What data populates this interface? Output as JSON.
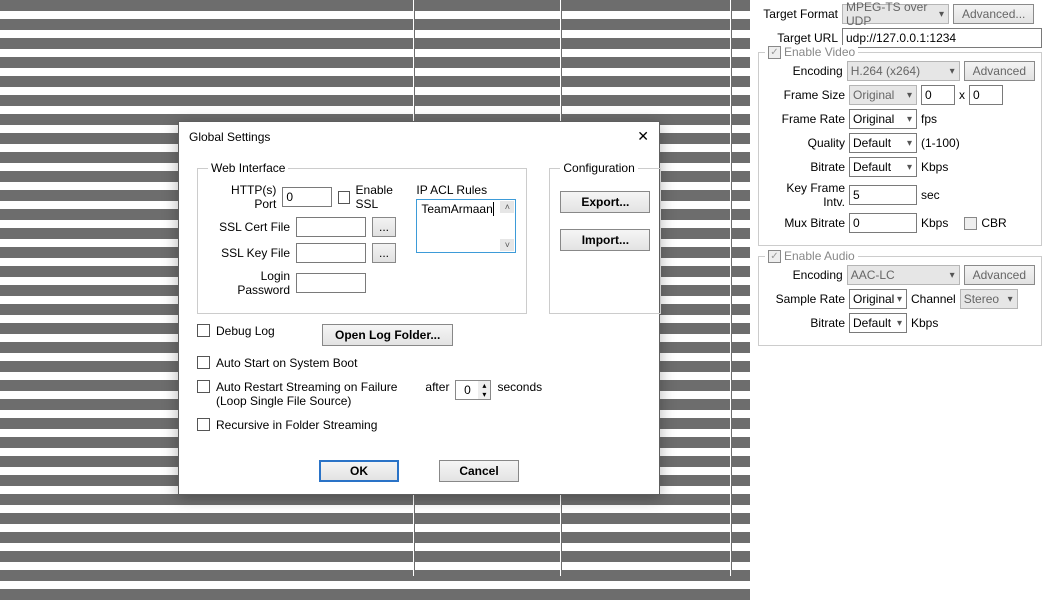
{
  "side": {
    "target_format_label": "Target Format",
    "target_format_value": "MPEG-TS over UDP",
    "advanced_btn": "Advanced...",
    "target_url_label": "Target URL",
    "target_url_value": "udp://127.0.0.1:1234",
    "enable_video_label": "Enable Video",
    "enable_audio_label": "Enable Audio",
    "video": {
      "encoding_label": "Encoding",
      "encoding_value": "H.264 (x264)",
      "encoding_advanced": "Advanced",
      "frame_size_label": "Frame Size",
      "frame_size_value": "Original",
      "frame_size_w": "0",
      "frame_size_x": "x",
      "frame_size_h": "0",
      "frame_rate_label": "Frame Rate",
      "frame_rate_value": "Original",
      "frame_rate_unit": "fps",
      "quality_label": "Quality",
      "quality_value": "Default",
      "quality_hint": "(1-100)",
      "bitrate_label": "Bitrate",
      "bitrate_value": "Default",
      "bitrate_unit": "Kbps",
      "key_frame_label": "Key Frame Intv.",
      "key_frame_value": "5",
      "key_frame_unit": "sec",
      "mux_bitrate_label": "Mux Bitrate",
      "mux_bitrate_value": "0",
      "mux_bitrate_unit": "Kbps",
      "cbr_label": "CBR"
    },
    "audio": {
      "encoding_label": "Encoding",
      "encoding_value": "AAC-LC",
      "encoding_advanced": "Advanced",
      "sample_rate_label": "Sample Rate",
      "sample_rate_value": "Original",
      "channel_label": "Channel",
      "channel_value": "Stereo",
      "bitrate_label": "Bitrate",
      "bitrate_value": "Default",
      "bitrate_unit": "Kbps"
    }
  },
  "dialog": {
    "title": "Global Settings",
    "web_interface": "Web Interface",
    "http_port_label": "HTTP(s) Port",
    "http_port_value": "0",
    "enable_ssl": "Enable SSL",
    "ssl_cert_label": "SSL Cert File",
    "ssl_key_label": "SSL Key File",
    "login_pw_label": "Login Password",
    "browse": "...",
    "ip_acl_label": "IP ACL Rules",
    "ip_acl_value": "TeamArmaan",
    "configuration": "Configuration",
    "export_btn": "Export...",
    "import_btn": "Import...",
    "debug_log": "Debug Log",
    "open_log_btn": "Open Log Folder...",
    "auto_start": "Auto Start on System Boot",
    "auto_restart": "Auto Restart Streaming on Failure",
    "auto_restart_sub": "(Loop Single File Source)",
    "after_label": "after",
    "after_value": "0",
    "seconds_label": "seconds",
    "recursive": "Recursive in Folder Streaming",
    "ok": "OK",
    "cancel": "Cancel"
  }
}
